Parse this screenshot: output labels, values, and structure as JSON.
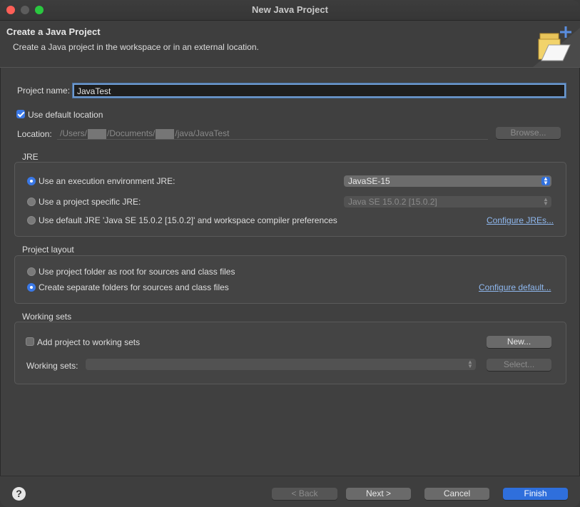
{
  "window": {
    "title": "New Java Project"
  },
  "header": {
    "title": "Create a Java Project",
    "description": "Create a Java project in the workspace or in an external location."
  },
  "project": {
    "name_label": "Project name:",
    "name_value": "JavaTest"
  },
  "location": {
    "use_default_label": "Use default location",
    "use_default_checked": true,
    "label": "Location:",
    "path_parts": [
      "/Users/",
      "/Documents/",
      "/java/JavaTest"
    ],
    "browse_label": "Browse..."
  },
  "jre": {
    "group_label": "JRE",
    "execution_env_label": "Use an execution environment JRE:",
    "execution_env_value": "JavaSE-15",
    "project_specific_label": "Use a project specific JRE:",
    "project_specific_value": "Java SE 15.0.2 [15.0.2]",
    "default_label": "Use default JRE 'Java SE 15.0.2 [15.0.2]' and workspace compiler preferences",
    "configure_link": "Configure JREs..."
  },
  "layout": {
    "group_label": "Project layout",
    "root_label": "Use project folder as root for sources and class files",
    "separate_label": "Create separate folders for sources and class files",
    "configure_link": "Configure default..."
  },
  "working_sets": {
    "group_label": "Working sets",
    "add_label": "Add project to working sets",
    "add_checked": false,
    "new_label": "New...",
    "sets_label": "Working sets:",
    "select_label": "Select..."
  },
  "footer": {
    "help": "?",
    "back": "< Back",
    "next": "Next >",
    "cancel": "Cancel",
    "finish": "Finish"
  },
  "colors": {
    "accent": "#2f6fdc",
    "link": "#8fb8ef"
  }
}
